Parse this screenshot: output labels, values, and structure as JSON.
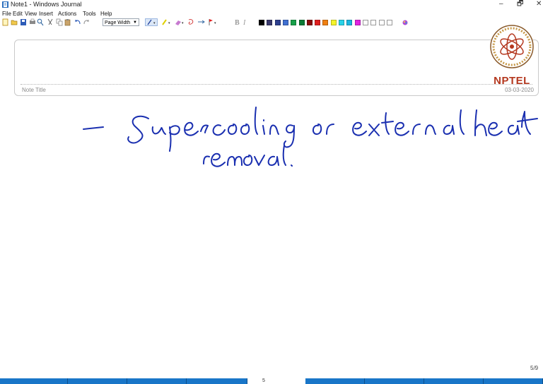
{
  "window": {
    "title": "Note1 - Windows Journal",
    "controls": [
      "–",
      "🗗",
      "✕"
    ]
  },
  "menu": [
    "File",
    "Edit",
    "View",
    "Insert",
    "Actions",
    "Tools",
    "Help"
  ],
  "toolbar": {
    "zoom_value": "Page Width",
    "icons": [
      "new-note-icon",
      "open-icon",
      "save-icon",
      "print-preview-icon",
      "find-icon",
      "cut-icon",
      "copy-icon",
      "paste-icon",
      "undo-icon",
      "redo-icon"
    ],
    "pen_icons": [
      "pen-icon",
      "highlighter-icon",
      "eraser-icon",
      "selection-tool-icon",
      "insert-space-icon",
      "flag-icon",
      "bold-icon",
      "italic-icon"
    ],
    "swatch_colors": [
      "#000000",
      "#3a3a6e",
      "#2e3f8f",
      "#3f6fd0",
      "#17a049",
      "#0b7a35",
      "#8a0b0b",
      "#e01f1f",
      "#ef7f11",
      "#f4f42b",
      "#28d3e8",
      "#1bb6e0",
      "#e024e0",
      "#ffffff",
      "#ffffff",
      "#ffffff",
      "#ffffff"
    ]
  },
  "note": {
    "title_label": "Note Title",
    "date": "03-03-2020"
  },
  "logo": {
    "text": "NPTEL"
  },
  "handwriting": {
    "line1": "– Supercooling or external heat",
    "line2": "removal."
  },
  "status": {
    "page_counter": "5/9",
    "page_number": "5"
  }
}
